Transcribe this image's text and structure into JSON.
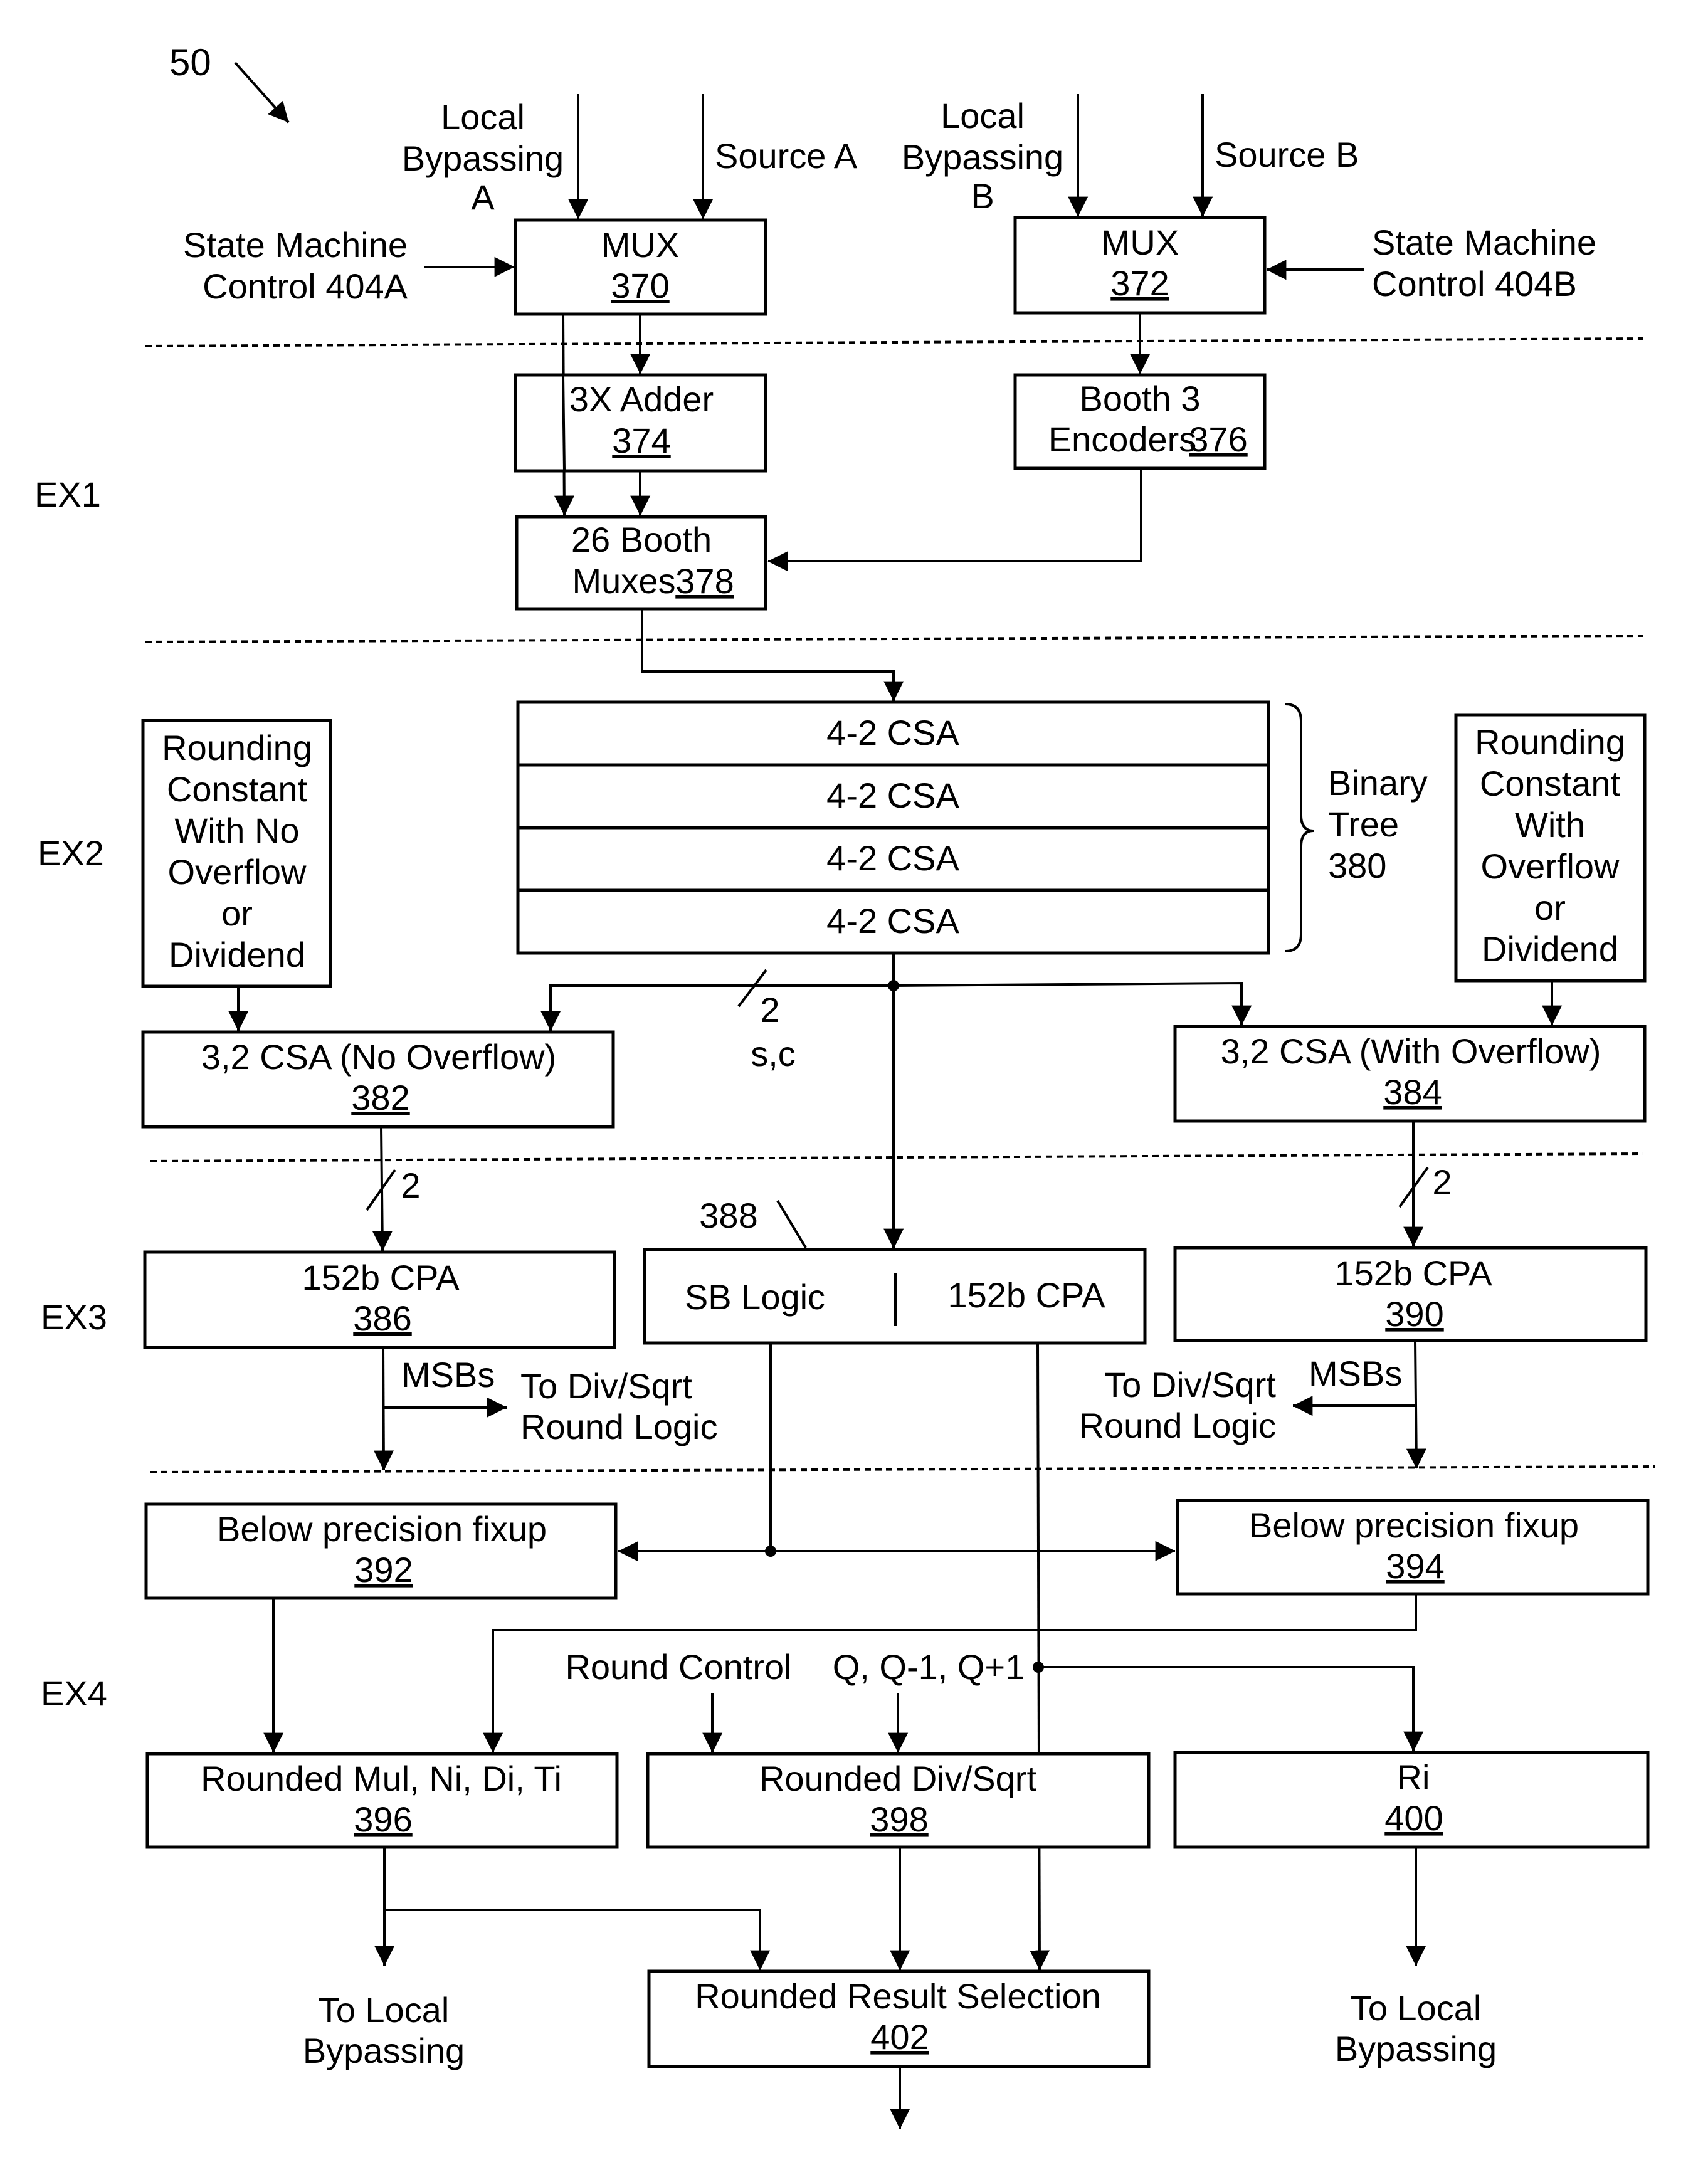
{
  "figure": {
    "ref_label": "50",
    "stages": [
      "EX1",
      "EX2",
      "EX3",
      "EX4"
    ]
  },
  "inputs": {
    "local_bypass_a": [
      "Local",
      "Bypassing",
      "A"
    ],
    "source_a": "Source A",
    "local_bypass_b": [
      "Local",
      "Bypassing",
      "B"
    ],
    "source_b": "Source B",
    "state_machine_a": [
      "State Machine",
      "Control 404A"
    ],
    "state_machine_b": [
      "State Machine",
      "Control 404B"
    ]
  },
  "blocks": {
    "mux_a": {
      "title": "MUX",
      "ref": "370"
    },
    "mux_b": {
      "title": "MUX",
      "ref": "372"
    },
    "adder3x": {
      "title": "3X Adder",
      "ref": "374"
    },
    "booth_enc": {
      "title": "Booth 3",
      "title2": "Encoders",
      "ref": "376"
    },
    "booth_mux": {
      "title": "26 Booth",
      "title2": "Muxes",
      "ref": "378"
    },
    "csa_tree": {
      "rows": [
        "4-2 CSA",
        "4-2 CSA",
        "4-2 CSA",
        "4-2 CSA"
      ],
      "brace_label": [
        "Binary",
        "Tree",
        "380"
      ]
    },
    "round_const_no": {
      "lines": [
        "Rounding",
        "Constant",
        "With No",
        "Overflow",
        "or",
        "Dividend"
      ]
    },
    "round_const_with": {
      "lines": [
        "Rounding",
        "Constant",
        "With",
        "Overflow",
        "or",
        "Dividend"
      ]
    },
    "csa32_no": {
      "title": "3,2 CSA (No Overflow)",
      "ref": "382"
    },
    "csa32_with": {
      "title": "3,2 CSA (With Overflow)",
      "ref": "384"
    },
    "cpa_left": {
      "title": "152b CPA",
      "ref": "386"
    },
    "sb_cpa": {
      "left": "SB Logic",
      "right": "152b CPA",
      "ref": "388"
    },
    "cpa_right": {
      "title": "152b CPA",
      "ref": "390"
    },
    "fixup_left": {
      "title": "Below precision fixup",
      "ref": "392"
    },
    "fixup_right": {
      "title": "Below precision fixup",
      "ref": "394"
    },
    "rounded_mul": {
      "title": "Rounded Mul, Ni, Di, Ti",
      "ref": "396"
    },
    "rounded_div": {
      "title": "Rounded Div/Sqrt",
      "ref": "398"
    },
    "ri": {
      "title": "Ri",
      "ref": "400"
    },
    "result_sel": {
      "title": "Rounded Result Selection",
      "ref": "402"
    }
  },
  "annotations": {
    "bus_width": "2",
    "sum_carry": "s,c",
    "msbs": "MSBs",
    "to_div_sqrt": [
      "To Div/Sqrt",
      "Round Logic"
    ],
    "round_control": "Round Control",
    "q_values": "Q, Q-1, Q+1",
    "to_local_bypass": [
      "To Local",
      "Bypassing"
    ]
  }
}
